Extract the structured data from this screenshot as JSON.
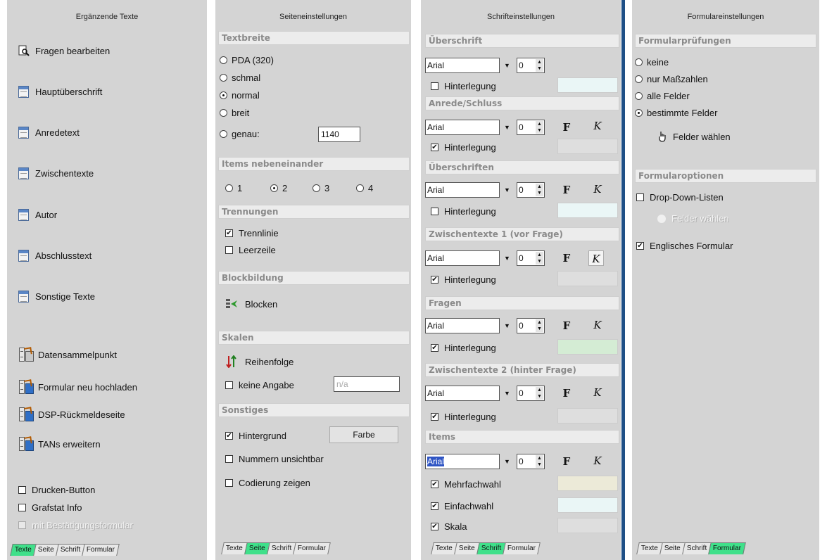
{
  "panel1": {
    "title": "Ergänzende Texte",
    "items": [
      {
        "label": "Fragen bearbeiten",
        "icon": "search-page-icon"
      },
      {
        "label": "Hauptüberschrift",
        "icon": "document-icon"
      },
      {
        "label": "Anredetext",
        "icon": "document-icon"
      },
      {
        "label": "Zwischentexte",
        "icon": "document-icon"
      },
      {
        "label": "Autor",
        "icon": "document-icon"
      },
      {
        "label": "Abschlusstext",
        "icon": "document-icon"
      },
      {
        "label": "Sonstige Texte",
        "icon": "document-icon"
      },
      {
        "label": "Datensammelpunkt",
        "icon": "server-icon"
      },
      {
        "label": "Formular neu hochladen",
        "icon": "server-upload-icon"
      },
      {
        "label": "DSP-Rückmeldeseite",
        "icon": "server-upload-icon"
      },
      {
        "label": "TANs erweitern",
        "icon": "server-upload-icon"
      }
    ],
    "checkboxes": [
      {
        "label": "Drucken-Button",
        "checked": false,
        "disabled": false
      },
      {
        "label": "Grafstat Info",
        "checked": false,
        "disabled": false
      },
      {
        "label": "mit Bestätigungsformular",
        "checked": false,
        "disabled": true
      }
    ]
  },
  "tabs": {
    "texte": "Texte",
    "seite": "Seite",
    "schrift": "Schrift",
    "formular": "Formular"
  },
  "panel2": {
    "title": "Seiteneinstellungen",
    "textbreite": {
      "header": "Textbreite",
      "options": [
        "PDA (320)",
        "schmal",
        "normal",
        "breit",
        "genau:"
      ],
      "selected": "normal",
      "exact_value": "1140"
    },
    "items": {
      "header": "Items nebeneinander",
      "options": [
        "1",
        "2",
        "3",
        "4"
      ],
      "selected": "2"
    },
    "trennungen": {
      "header": "Trennungen",
      "trennlinie": {
        "label": "Trennlinie",
        "checked": true
      },
      "leerzeile": {
        "label": "Leerzeile",
        "checked": false
      }
    },
    "blockbildung": {
      "header": "Blockbildung",
      "button": "Blocken"
    },
    "skalen": {
      "header": "Skalen",
      "reihenfolge": "Reihenfolge",
      "keine_angabe": {
        "label": "keine Angabe",
        "checked": false
      },
      "placeholder": "n/a"
    },
    "sonstiges": {
      "header": "Sonstiges",
      "hintergrund": {
        "label": "Hintergrund",
        "checked": true
      },
      "farbe_button": "Farbe",
      "nummern": {
        "label": "Nummern unsichtbar",
        "checked": false
      },
      "codierung": {
        "label": "Codierung zeigen",
        "checked": false
      }
    }
  },
  "panel3": {
    "title": "Schrifteinstellungen",
    "font": "Arial",
    "size": "0",
    "bold_label": "F",
    "italic_label": "K",
    "hinterlegung": "Hinterlegung",
    "sections": [
      {
        "header": "Überschrift",
        "hinterlegung_checked": false,
        "swatch": "#eaf6f6"
      },
      {
        "header": "Anrede/Schluss",
        "hinterlegung_checked": true,
        "swatch": "#dedede"
      },
      {
        "header": "Überschriften",
        "hinterlegung_checked": false,
        "swatch": "#eaf6f6"
      },
      {
        "header": "Zwischentexte 1 (vor Frage)",
        "hinterlegung_checked": true,
        "swatch": "#dedede"
      },
      {
        "header": "Fragen",
        "hinterlegung_checked": true,
        "swatch": "#d4ecd4"
      },
      {
        "header": "Zwischentexte 2 (hinter Frage)",
        "hinterlegung_checked": true,
        "swatch": "#dedede"
      }
    ],
    "items_section": {
      "header": "Items",
      "checks": [
        {
          "label": "Mehrfachwahl",
          "checked": true,
          "swatch": "#ecead8"
        },
        {
          "label": "Einfachwahl",
          "checked": true,
          "swatch": "#eaf6f6"
        },
        {
          "label": "Skala",
          "checked": true,
          "swatch": "#dedede"
        }
      ]
    }
  },
  "panel4": {
    "title": "Formulareinstellungen",
    "pruefungen": {
      "header": "Formularprüfungen",
      "options": [
        "keine",
        "nur Maßzahlen",
        "alle Felder",
        "bestimmte Felder"
      ],
      "selected": "bestimmte Felder",
      "button": "Felder wählen"
    },
    "optionen": {
      "header": "Formularoptionen",
      "dropdown": {
        "label": "Drop-Down-Listen",
        "checked": false
      },
      "button_disabled": "Felder wählen",
      "englisch": {
        "label": "Englisches Formular",
        "checked": true
      }
    }
  },
  "colors": {
    "panel_bg": "#d4d4d4",
    "tab_active": "#3fe08a",
    "scrollbar": "#1f4f86"
  }
}
